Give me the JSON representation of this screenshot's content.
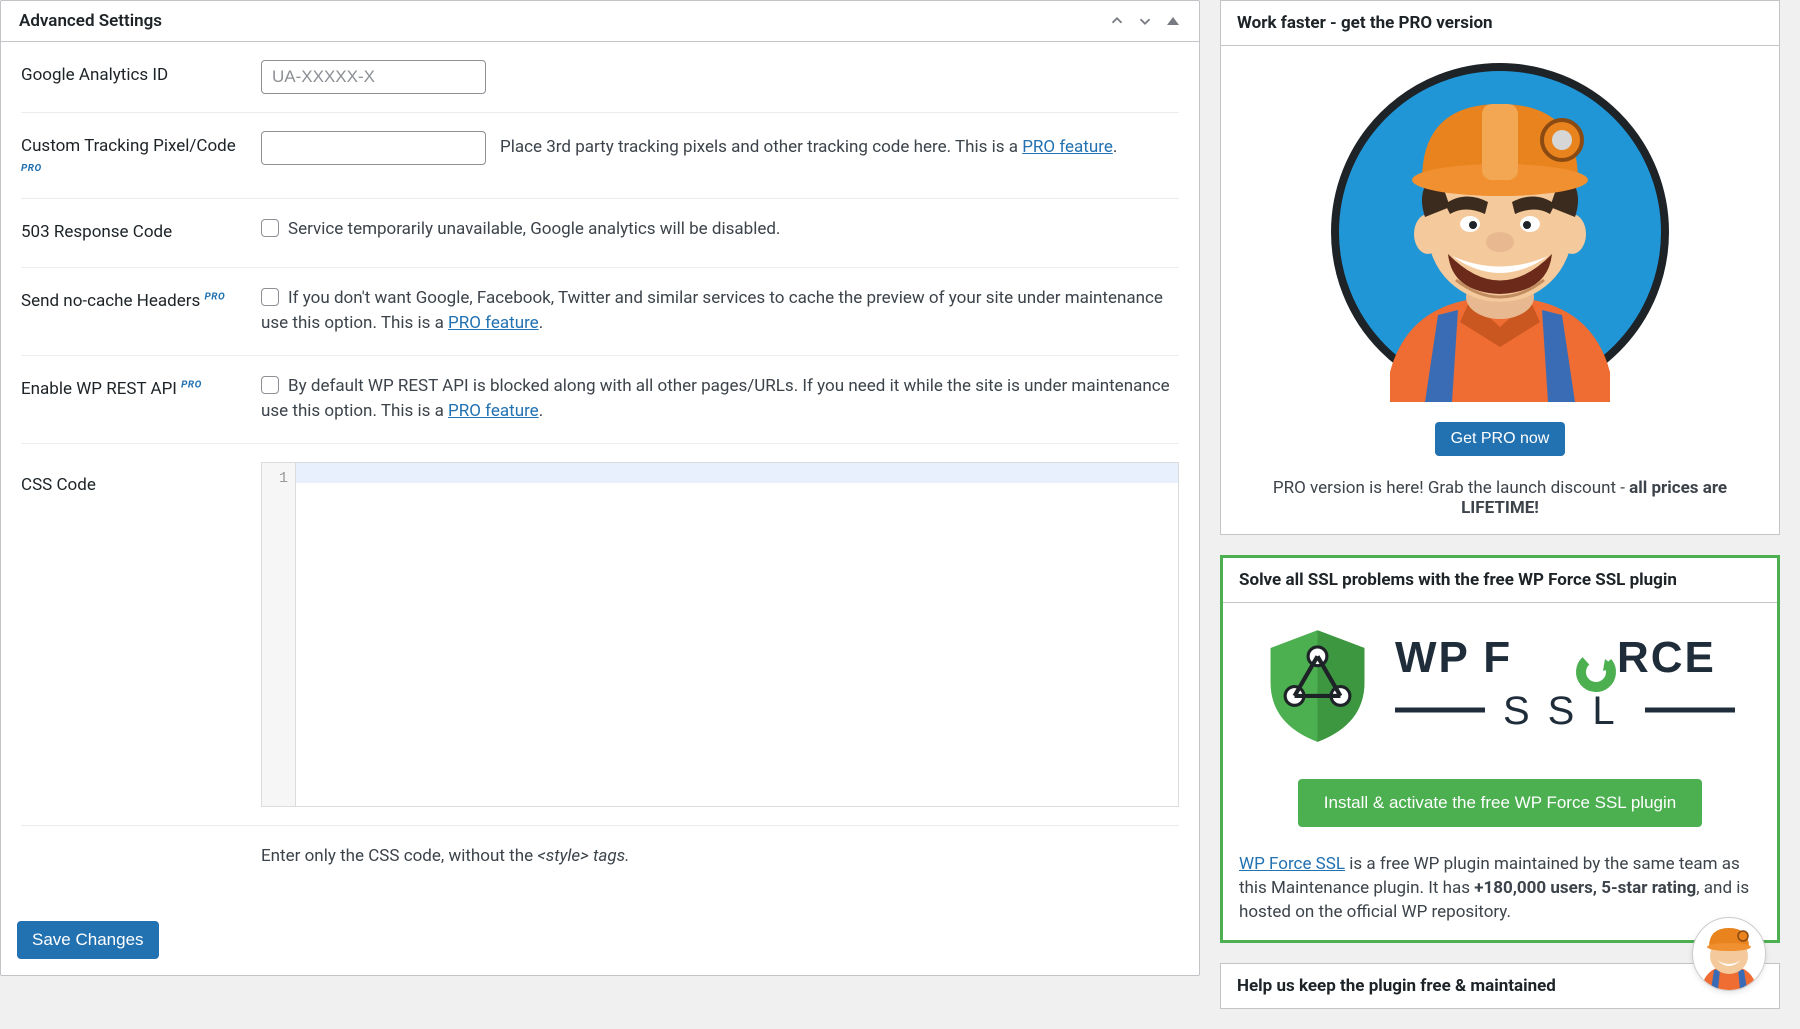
{
  "main": {
    "title": "Advanced Settings",
    "fields": {
      "ga": {
        "label": "Google Analytics ID",
        "placeholder": "UA-XXXXX-X"
      },
      "tracking": {
        "label": "Custom Tracking Pixel/Code",
        "pro_tag": "PRO",
        "desc_pre": "Place 3rd party tracking pixels and other tracking code here. This is a ",
        "link": "PRO feature",
        "desc_post": "."
      },
      "resp503": {
        "label": "503 Response Code",
        "checkbox_text": "Service temporarily unavailable, Google analytics will be disabled."
      },
      "nocache": {
        "label": "Send no-cache Headers",
        "pro_tag": "PRO",
        "desc_pre": "If you don't want Google, Facebook, Twitter and similar services to cache the preview of your site under maintenance use this option. This is a ",
        "link": "PRO feature",
        "desc_post": "."
      },
      "rest": {
        "label": "Enable WP REST API",
        "pro_tag": "PRO",
        "desc_pre": "By default WP REST API is blocked along with all other pages/URLs. If you need it while the site is under maintenance use this option. This is a ",
        "link": "PRO feature",
        "desc_post": "."
      },
      "css": {
        "label": "CSS Code",
        "line1": "1",
        "desc_pre": "Enter only the CSS code, without the ",
        "desc_em": "<style> tags."
      }
    },
    "save": "Save Changes"
  },
  "sidebar": {
    "pro": {
      "title": "Work faster - get the PRO version",
      "button": "Get PRO now",
      "text_pre": "PRO version is here! Grab the launch discount - ",
      "text_bold": "all prices are LIFETIME!"
    },
    "ssl": {
      "title": "Solve all SSL problems with the free WP Force SSL plugin",
      "logo_top": "WP FORCE",
      "logo_bot": "S S L",
      "button": "Install & activate the free WP Force SSL plugin",
      "link": "WP Force SSL",
      "desc1": " is a free WP plugin maintained by the same team as this Maintenance plugin. It has ",
      "bold": "+180,000 users, 5-star rating",
      "desc2": ", and is hosted on the official WP repository."
    },
    "help": {
      "title": "Help us keep the plugin free & maintained"
    }
  }
}
